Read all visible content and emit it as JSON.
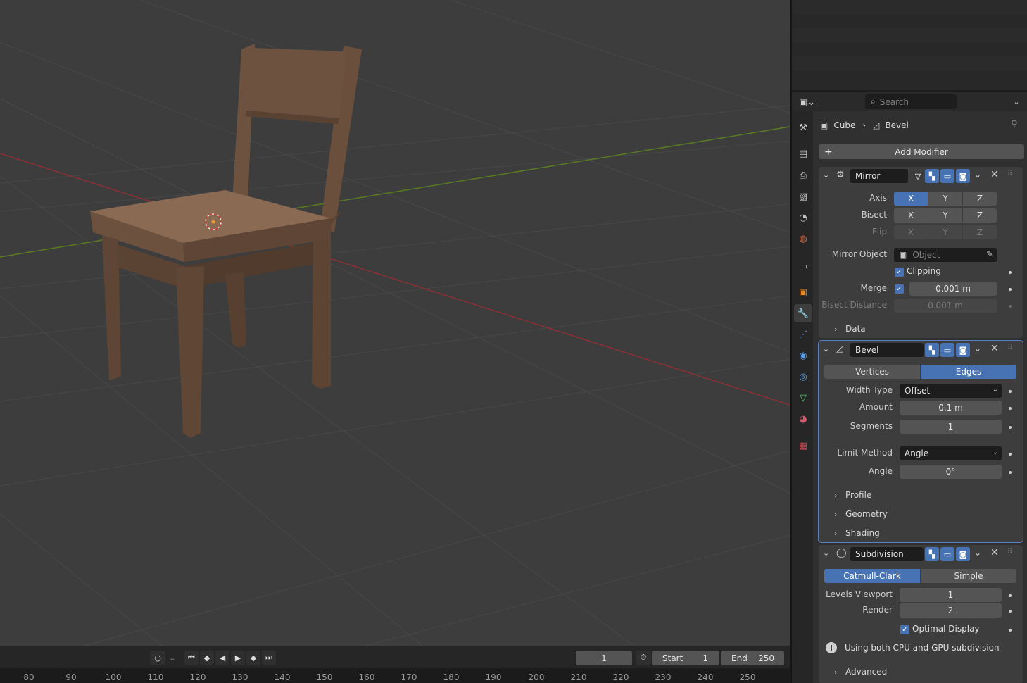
{
  "viewport": {
    "name": "3D Viewport",
    "object": "chair"
  },
  "timeline": {
    "current_frame": "1",
    "start_label": "Start",
    "start_value": "1",
    "end_label": "End",
    "end_value": "250",
    "ruler": [
      "80",
      "90",
      "100",
      "110",
      "120",
      "130",
      "140",
      "150",
      "160",
      "170",
      "180",
      "190",
      "200",
      "210",
      "220",
      "230",
      "240",
      "250"
    ]
  },
  "properties": {
    "search_placeholder": "Search",
    "breadcrumb": {
      "object": "Cube",
      "modifier": "Bevel"
    },
    "add_modifier": "Add Modifier",
    "mirror": {
      "name": "Mirror",
      "axis_label": "Axis",
      "bisect_label": "Bisect",
      "flip_label": "Flip",
      "axes": [
        "X",
        "Y",
        "Z"
      ],
      "mirror_object_label": "Mirror Object",
      "object_placeholder": "Object",
      "clipping_label": "Clipping",
      "merge_label": "Merge",
      "merge_value": "0.001 m",
      "bisect_distance_label": "Bisect Distance",
      "bisect_distance_value": "0.001 m",
      "data_label": "Data"
    },
    "bevel": {
      "name": "Bevel",
      "mode_vertices": "Vertices",
      "mode_edges": "Edges",
      "width_type_label": "Width Type",
      "width_type_value": "Offset",
      "amount_label": "Amount",
      "amount_value": "0.1 m",
      "segments_label": "Segments",
      "segments_value": "1",
      "limit_method_label": "Limit Method",
      "limit_method_value": "Angle",
      "angle_label": "Angle",
      "angle_value": "0°",
      "profile_label": "Profile",
      "geometry_label": "Geometry",
      "shading_label": "Shading"
    },
    "subdivision": {
      "name": "Subdivision",
      "mode_catmull": "Catmull-Clark",
      "mode_simple": "Simple",
      "levels_viewport_label": "Levels Viewport",
      "levels_viewport_value": "1",
      "render_label": "Render",
      "render_value": "2",
      "optimal_display_label": "Optimal Display",
      "info_text": "Using both CPU and GPU subdivision",
      "advanced_label": "Advanced"
    }
  },
  "colors": {
    "accent": "#4772b3",
    "x_axis": "#b0393f",
    "y_axis": "#6b8e23",
    "active_outline": "#5681c2"
  }
}
